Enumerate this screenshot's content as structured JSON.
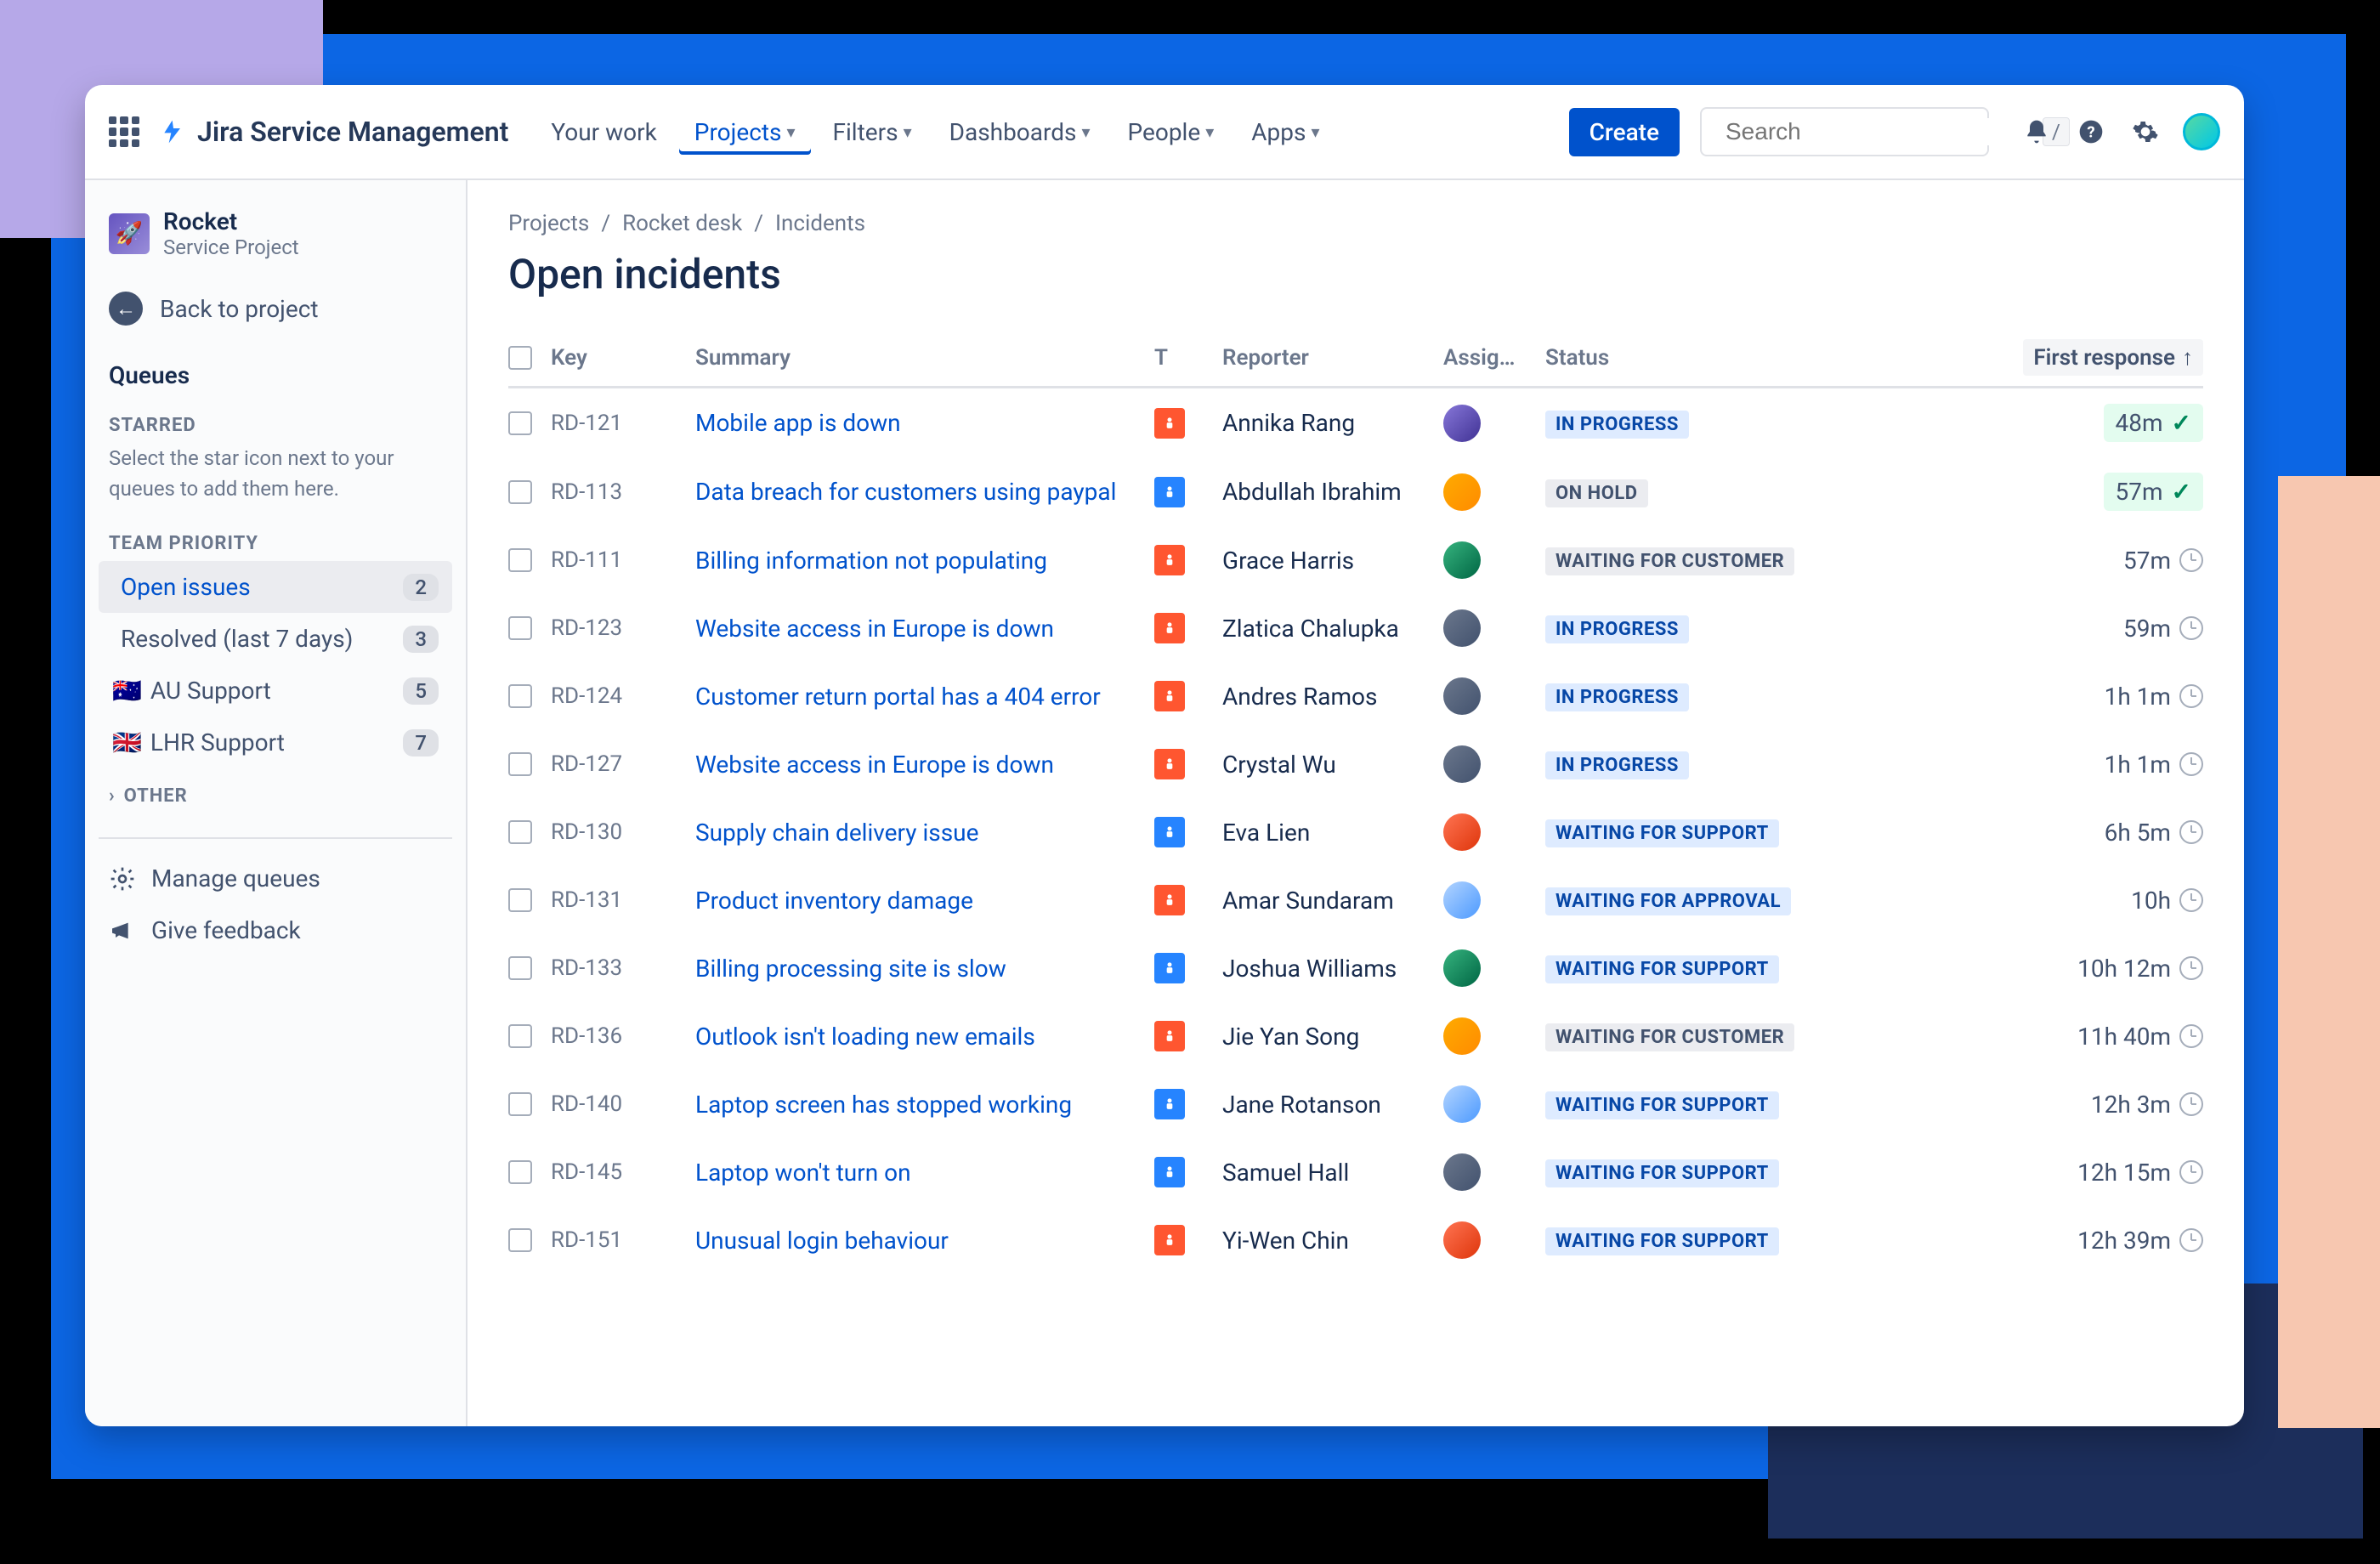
{
  "product": "Jira Service Management",
  "nav": {
    "your_work": "Your work",
    "projects": "Projects",
    "filters": "Filters",
    "dashboards": "Dashboards",
    "people": "People",
    "apps": "Apps",
    "create": "Create",
    "search_placeholder": "Search",
    "search_key": "/"
  },
  "project": {
    "name": "Rocket",
    "type": "Service Project",
    "back": "Back to project"
  },
  "sidebar": {
    "queues": "Queues",
    "starred": "STARRED",
    "starred_help": "Select the star icon next to your queues to add them here.",
    "team_priority": "TEAM PRIORITY",
    "items": [
      {
        "label": "Open issues",
        "count": "2",
        "active": true,
        "flag": ""
      },
      {
        "label": "Resolved (last 7 days)",
        "count": "3",
        "active": false,
        "flag": ""
      },
      {
        "label": "AU Support",
        "count": "5",
        "active": false,
        "flag": "🇦🇺"
      },
      {
        "label": "LHR Support",
        "count": "7",
        "active": false,
        "flag": "🇬🇧"
      }
    ],
    "other": "OTHER",
    "manage": "Manage queues",
    "feedback": "Give feedback"
  },
  "breadcrumb": [
    "Projects",
    "Rocket desk",
    "Incidents"
  ],
  "page_title": "Open incidents",
  "columns": {
    "key": "Key",
    "summary": "Summary",
    "t": "T",
    "reporter": "Reporter",
    "assignee": "Assig…",
    "status": "Status",
    "resp": "First response"
  },
  "rows": [
    {
      "key": "RD-121",
      "summary": "Mobile app is down",
      "type": "orange",
      "reporter": "Annika Rang",
      "a": "a1",
      "status": "IN PROGRESS",
      "st": "st-inprogress",
      "resp": "48m",
      "ok": true
    },
    {
      "key": "RD-113",
      "summary": "Data breach for customers using paypal",
      "type": "blue",
      "reporter": "Abdullah Ibrahim",
      "a": "a2",
      "status": "ON HOLD",
      "st": "st-onhold",
      "resp": "57m",
      "ok": true
    },
    {
      "key": "RD-111",
      "summary": "Billing information not populating",
      "type": "orange",
      "reporter": "Grace Harris",
      "a": "a3",
      "status": "WAITING FOR CUSTOMER",
      "st": "st-waitcust",
      "resp": "57m",
      "ok": false
    },
    {
      "key": "RD-123",
      "summary": "Website access in Europe is down",
      "type": "orange",
      "reporter": "Zlatica Chalupka",
      "a": "a4",
      "status": "IN PROGRESS",
      "st": "st-inprogress",
      "resp": "59m",
      "ok": false
    },
    {
      "key": "RD-124",
      "summary": "Customer return portal has a 404 error",
      "type": "orange",
      "reporter": "Andres Ramos",
      "a": "a4",
      "status": "IN PROGRESS",
      "st": "st-inprogress",
      "resp": "1h 1m",
      "ok": false
    },
    {
      "key": "RD-127",
      "summary": "Website access in Europe is down",
      "type": "orange",
      "reporter": "Crystal Wu",
      "a": "a4",
      "status": "IN PROGRESS",
      "st": "st-inprogress",
      "resp": "1h 1m",
      "ok": false
    },
    {
      "key": "RD-130",
      "summary": "Supply chain delivery issue",
      "type": "blue",
      "reporter": "Eva Lien",
      "a": "a5",
      "status": "WAITING FOR SUPPORT",
      "st": "st-waitsup",
      "resp": "6h 5m",
      "ok": false
    },
    {
      "key": "RD-131",
      "summary": "Product inventory damage",
      "type": "orange",
      "reporter": "Amar Sundaram",
      "a": "a6",
      "status": "WAITING FOR APPROVAL",
      "st": "st-waitapp",
      "resp": "10h",
      "ok": false
    },
    {
      "key": "RD-133",
      "summary": "Billing processing site is slow",
      "type": "blue",
      "reporter": "Joshua Williams",
      "a": "a3",
      "status": "WAITING FOR SUPPORT",
      "st": "st-waitsup",
      "resp": "10h 12m",
      "ok": false
    },
    {
      "key": "RD-136",
      "summary": "Outlook isn't loading new emails",
      "type": "orange",
      "reporter": "Jie Yan Song",
      "a": "a2",
      "status": "WAITING FOR CUSTOMER",
      "st": "st-waitcust",
      "resp": "11h 40m",
      "ok": false
    },
    {
      "key": "RD-140",
      "summary": "Laptop screen has stopped working",
      "type": "blue",
      "reporter": "Jane Rotanson",
      "a": "a6",
      "status": "WAITING FOR SUPPORT",
      "st": "st-waitsup",
      "resp": "12h 3m",
      "ok": false
    },
    {
      "key": "RD-145",
      "summary": "Laptop won't turn on",
      "type": "blue",
      "reporter": "Samuel Hall",
      "a": "a4",
      "status": "WAITING FOR SUPPORT",
      "st": "st-waitsup",
      "resp": "12h 15m",
      "ok": false
    },
    {
      "key": "RD-151",
      "summary": "Unusual login behaviour",
      "type": "orange",
      "reporter": "Yi-Wen Chin",
      "a": "a5",
      "status": "WAITING FOR SUPPORT",
      "st": "st-waitsup",
      "resp": "12h 39m",
      "ok": false
    }
  ]
}
